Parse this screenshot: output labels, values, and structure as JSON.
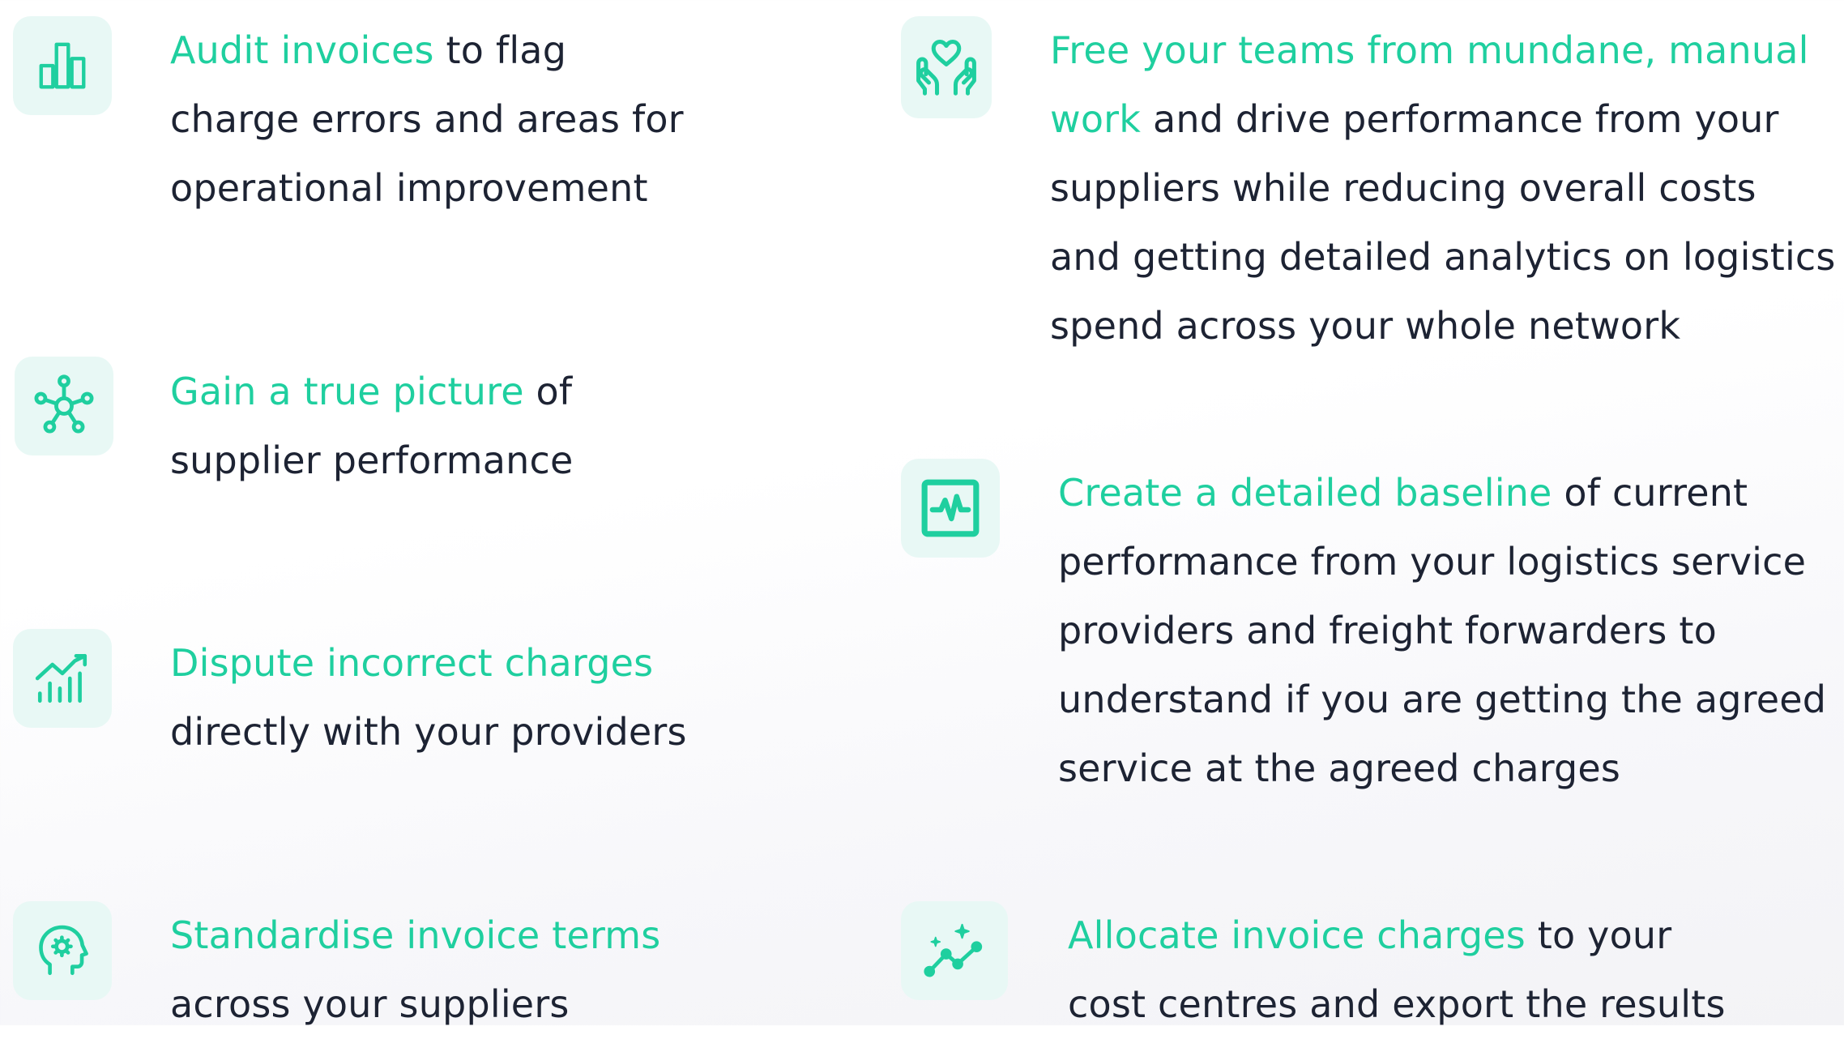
{
  "features": [
    {
      "id": "audit",
      "icon": "bar-chart-icon",
      "lines": [
        {
          "hl": "Audit invoices",
          "rest": " to flag"
        },
        {
          "hl": "",
          "rest": "charge errors and areas for"
        },
        {
          "hl": "",
          "rest": "operational improvement"
        }
      ]
    },
    {
      "id": "gain",
      "icon": "network-hub-icon",
      "lines": [
        {
          "hl": "Gain a true picture",
          "rest": " of"
        },
        {
          "hl": "",
          "rest": "supplier performance"
        }
      ]
    },
    {
      "id": "dispute",
      "icon": "rising-chart-icon",
      "lines": [
        {
          "hl": "Dispute incorrect charges",
          "rest": ""
        },
        {
          "hl": "",
          "rest": "directly with your providers"
        }
      ]
    },
    {
      "id": "standardise",
      "icon": "head-gear-icon",
      "lines": [
        {
          "hl": "Standardise invoice terms",
          "rest": ""
        },
        {
          "hl": "",
          "rest": "across your suppliers"
        }
      ]
    },
    {
      "id": "free",
      "icon": "hands-heart-icon",
      "lines": [
        {
          "hl": "Free your teams from mundane, manual",
          "rest": ""
        },
        {
          "hl": "work",
          "rest": " and drive performance from your"
        },
        {
          "hl": "",
          "rest": "suppliers while reducing overall costs"
        },
        {
          "hl": "",
          "rest": "and getting detailed analytics on logistics"
        },
        {
          "hl": "",
          "rest": "spend across your whole network"
        }
      ]
    },
    {
      "id": "baseline",
      "icon": "pulse-monitor-icon",
      "lines": [
        {
          "hl": "Create a detailed baseline",
          "rest": " of current"
        },
        {
          "hl": "",
          "rest": "performance from your logistics service"
        },
        {
          "hl": "",
          "rest": "providers and freight forwarders to"
        },
        {
          "hl": "",
          "rest": "understand if you are getting the agreed"
        },
        {
          "hl": "",
          "rest": "service at the agreed charges"
        }
      ]
    },
    {
      "id": "allocate",
      "icon": "sparkle-trend-icon",
      "lines": [
        {
          "hl": "Allocate invoice charges",
          "rest": " to your"
        },
        {
          "hl": "",
          "rest": "cost centres and export the results"
        }
      ]
    }
  ],
  "colors": {
    "accent": "#1fcf9f",
    "icon_bg": "#e8f8f5",
    "text": "#1d2333"
  }
}
